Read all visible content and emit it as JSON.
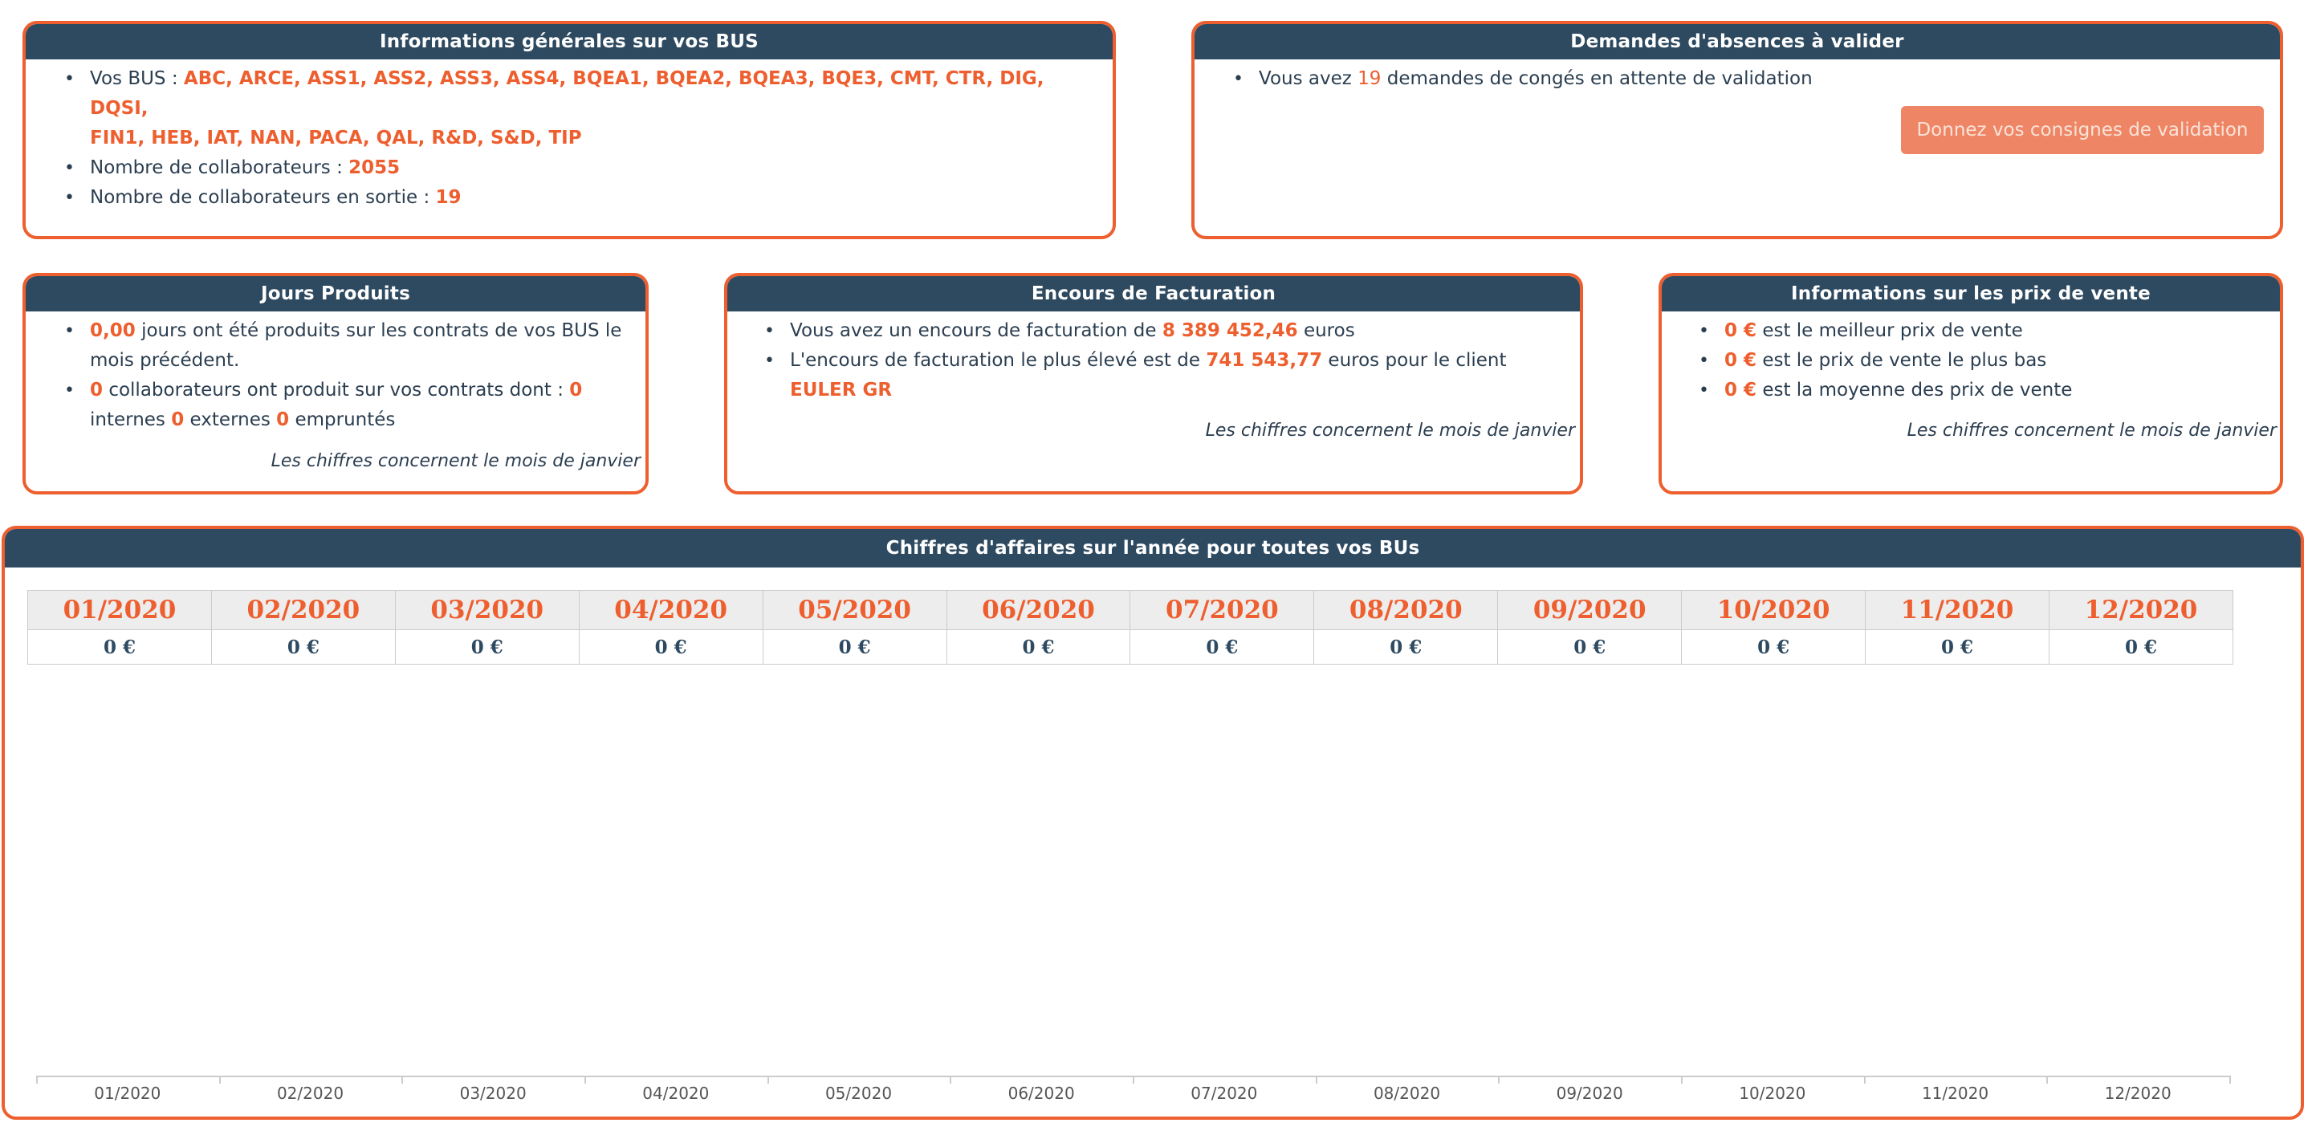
{
  "general": {
    "title": "Informations générales sur vos BUS",
    "bus_prefix": "Vos BUS :",
    "bus_list": "ABC, ARCE, ASS1, ASS2, ASS3, ASS4, BQEA1, BQEA2, BQEA3, BQE3, CMT, CTR, DIG, DQSI,",
    "bus_list_2": "FIN1, HEB, IAT, NAN, PACA, QAL, R&D, S&D, TIP",
    "collab_label": "Nombre de collaborateurs :",
    "collab_value": "2055",
    "exit_label": "Nombre de collaborateurs en sortie :",
    "exit_value": "19"
  },
  "absences": {
    "title": "Demandes d'absences à valider",
    "text_before": "Vous avez",
    "count": "19",
    "text_after": "demandes de congés en attente de validation",
    "button_label": "Donnez vos consignes de validation"
  },
  "jours": {
    "title": "Jours Produits",
    "days_value": "0,00",
    "days_text_1": "jours ont été produits sur les contrats de vos BUS le",
    "days_text_2": "mois précédent.",
    "collab_value": "0",
    "collab_text": "collaborateurs ont produit sur vos contrats dont :",
    "internes_value": "0",
    "internes_label": "internes",
    "externes_value": "0",
    "externes_label": "externes",
    "empruntes_value": "0",
    "empruntes_label": "empruntés",
    "note": "Les chiffres concernent le mois de janvier"
  },
  "encours": {
    "title": "Encours de Facturation",
    "line1_before": "Vous avez un encours de facturation de",
    "line1_value": "8 389 452,46",
    "line1_after": "euros",
    "line2_before": "L'encours de facturation le plus élevé est de",
    "line2_value": "741 543,77",
    "line2_after": "euros pour le client",
    "client": "EULER GR",
    "note": "Les chiffres concernent le mois de janvier"
  },
  "prix": {
    "title": "Informations sur les prix de vente",
    "best_value": "0 €",
    "best_text": "est le meilleur prix de vente",
    "low_value": "0 €",
    "low_text": "est le prix de vente le plus bas",
    "avg_value": "0 €",
    "avg_text": "est la moyenne des prix de vente",
    "note": "Les chiffres concernent le mois de janvier"
  },
  "ca": {
    "title": "Chiffres d'affaires sur l'année pour toutes vos BUs",
    "months": [
      "01/2020",
      "02/2020",
      "03/2020",
      "04/2020",
      "05/2020",
      "06/2020",
      "07/2020",
      "08/2020",
      "09/2020",
      "10/2020",
      "11/2020",
      "12/2020"
    ],
    "values": [
      "0 €",
      "0 €",
      "0 €",
      "0 €",
      "0 €",
      "0 €",
      "0 €",
      "0 €",
      "0 €",
      "0 €",
      "0 €",
      "0 €"
    ]
  },
  "chart_data": {
    "type": "bar",
    "categories": [
      "01/2020",
      "02/2020",
      "03/2020",
      "04/2020",
      "05/2020",
      "06/2020",
      "07/2020",
      "08/2020",
      "09/2020",
      "10/2020",
      "11/2020",
      "12/2020"
    ],
    "values": [
      0,
      0,
      0,
      0,
      0,
      0,
      0,
      0,
      0,
      0,
      0,
      0
    ],
    "title": "",
    "xlabel": "",
    "ylabel": "",
    "grid": false
  },
  "colors": {
    "accent": "#ee5f2f",
    "header": "#2e4a61",
    "text": "#2b3e50"
  }
}
